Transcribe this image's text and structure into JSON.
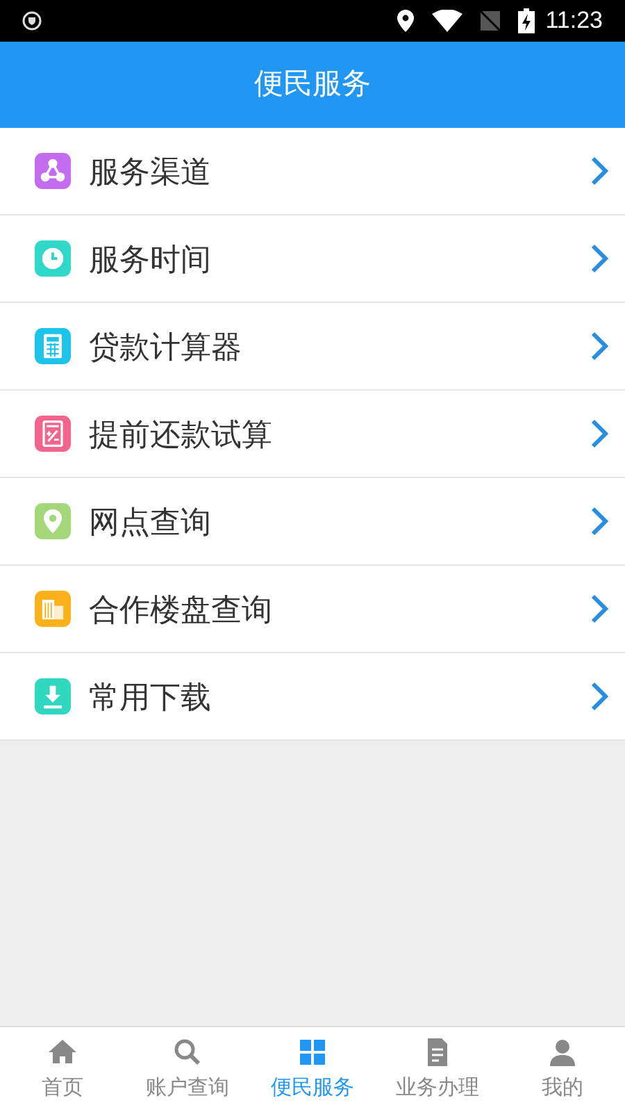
{
  "status_bar": {
    "time": "11:23"
  },
  "header": {
    "title": "便民服务"
  },
  "menu": [
    {
      "label": "服务渠道",
      "kind": "share",
      "color": "#c36cf0"
    },
    {
      "label": "服务时间",
      "kind": "clock",
      "color": "#2fd8c8"
    },
    {
      "label": "贷款计算器",
      "kind": "calculator",
      "color": "#1cc4ea"
    },
    {
      "label": "提前还款试算",
      "kind": "percent",
      "color": "#f2668e"
    },
    {
      "label": "网点查询",
      "kind": "pin",
      "color": "#a4d67a"
    },
    {
      "label": "合作楼盘查询",
      "kind": "building",
      "color": "#fbb21a"
    },
    {
      "label": "常用下载",
      "kind": "download",
      "color": "#30d8c0"
    }
  ],
  "tab_bar": [
    {
      "label": "首页",
      "kind": "home",
      "selected": false
    },
    {
      "label": "账户查询",
      "kind": "search",
      "selected": false
    },
    {
      "label": "便民服务",
      "kind": "grid",
      "selected": true
    },
    {
      "label": "业务办理",
      "kind": "doc",
      "selected": false
    },
    {
      "label": "我的",
      "kind": "person",
      "selected": false
    }
  ]
}
